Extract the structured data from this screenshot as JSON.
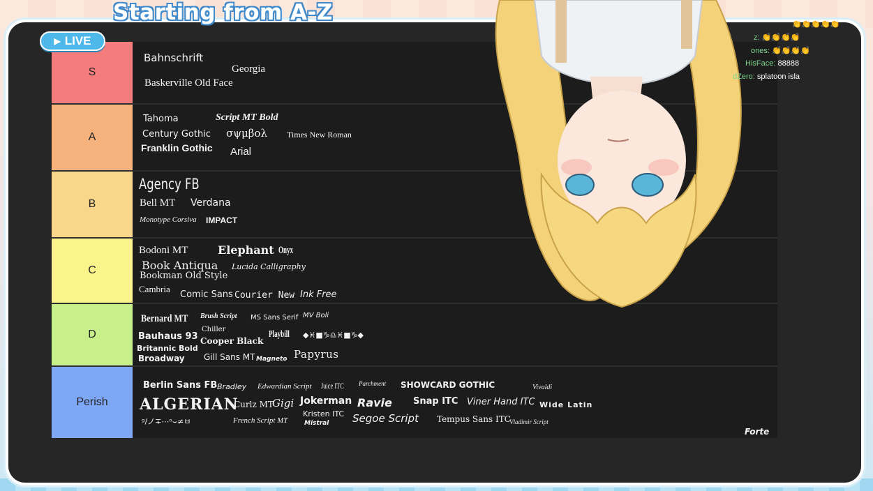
{
  "stream": {
    "title": "Starting from A-Z",
    "live_label": "LIVE"
  },
  "colors": {
    "S": "#f47c7c",
    "A": "#f5b27d",
    "B": "#f8d68a",
    "C": "#fbf38c",
    "D": "#c8f08a",
    "Perish": "#7ea8f6"
  },
  "tiers": [
    {
      "label": "S",
      "items": [
        "Bahnschrift",
        "Georgia",
        "Baskerville Old Face"
      ]
    },
    {
      "label": "A",
      "items": [
        "Tahoma",
        "Script MT Bold",
        "Century Gothic",
        "σψμβολ",
        "Times New Roman",
        "Franklin Gothic",
        "Arial"
      ]
    },
    {
      "label": "B",
      "items": [
        "Agency FB",
        "Bell MT",
        "Verdana",
        "Monotype Corsiva",
        "IMPACT"
      ]
    },
    {
      "label": "C",
      "items": [
        "Bodoni MT",
        "Elephant",
        "Onyx",
        "Book Antiqua",
        "Lucida Calligraphy",
        "Bookman Old Style",
        "Cambria",
        "Comic Sans",
        "Courier New",
        "Ink Free"
      ]
    },
    {
      "label": "D",
      "items": [
        "Bernard MT",
        "Brush Script",
        "MS Sans Serif",
        "MV Boli",
        "Chiller",
        "Bauhaus 93",
        "Cooper Black",
        "Playbill",
        "◆♓■♑♎♓■♑◆",
        "Britannic Bold",
        "Broadway",
        "Gill Sans MT",
        "Magneto",
        "Papyrus"
      ]
    },
    {
      "label": "Perish",
      "items": [
        "Berlin Sans FB",
        "Bradley",
        "Edwardian Script",
        "Juice ITC",
        "Parchment",
        "SHOWCARD GOTHIC",
        "Vivaldi",
        "ALGERIAN",
        "Curlz MT",
        "Gigi",
        "Jokerman",
        "Ravie",
        "Snap ITC",
        "Viner Hand ITC",
        "Wide Latin",
        "ᵍ/ノ∓⋯ᵒ⌣≠ㅂ",
        "French Script MT",
        "Kristen ITC",
        "Mistral",
        "Segoe Script",
        "Tempus Sans ITC",
        "Vladimir Script",
        "Forte"
      ]
    }
  ],
  "chat": [
    {
      "name": "z:",
      "text": "👏👏👏👏"
    },
    {
      "name": "ones:",
      "text": "👏👏👏👏"
    },
    {
      "name": "HisFace:",
      "text": "88888"
    },
    {
      "name": "dZero:",
      "text": "splatoon isla"
    }
  ],
  "chat_top": "👏👏👏👏👏"
}
